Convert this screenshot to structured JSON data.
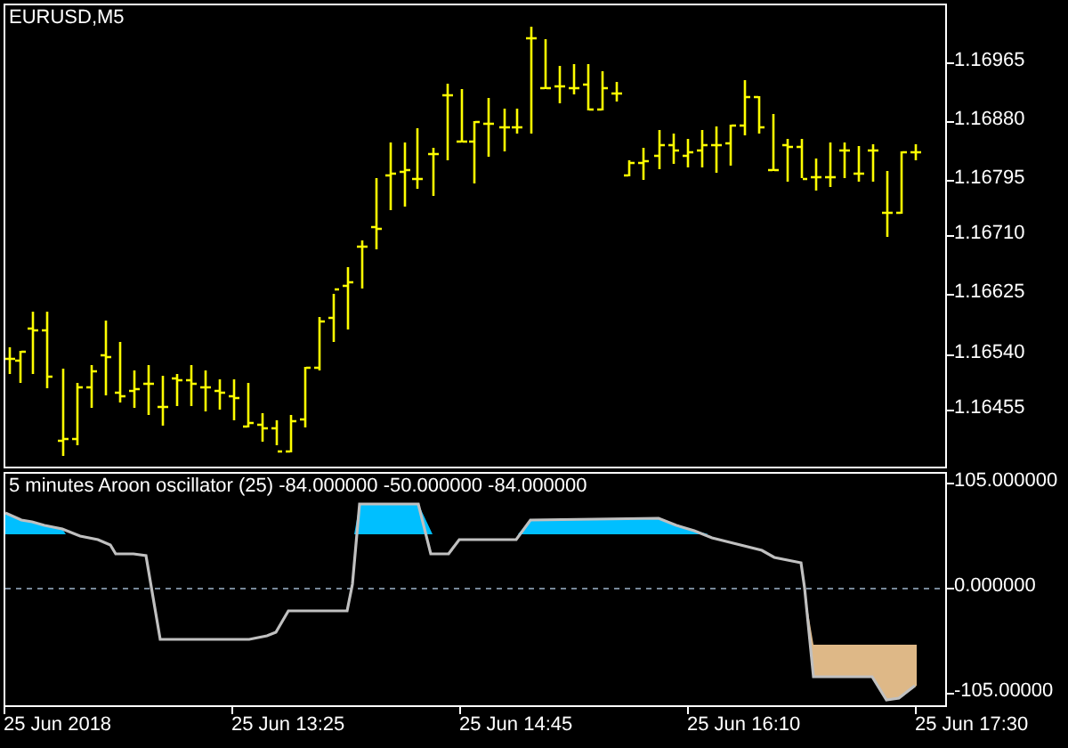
{
  "price_chart": {
    "symbol_label": "EURUSD,M5",
    "price_axis": [
      "1.16965",
      "1.16880",
      "1.16795",
      "1.16710",
      "1.16625",
      "1.16540",
      "1.16455"
    ]
  },
  "indicator": {
    "title": "5 minutes Aroon oscillator (25) -84.000000 -50.000000 -84.000000",
    "value_axis": [
      "105.000000",
      "0.000000",
      "-105.00000"
    ]
  },
  "time_axis": [
    "25 Jun 2018",
    "25 Jun 13:25",
    "25 Jun 14:45",
    "25 Jun 16:10",
    "25 Jun 17:30"
  ]
}
